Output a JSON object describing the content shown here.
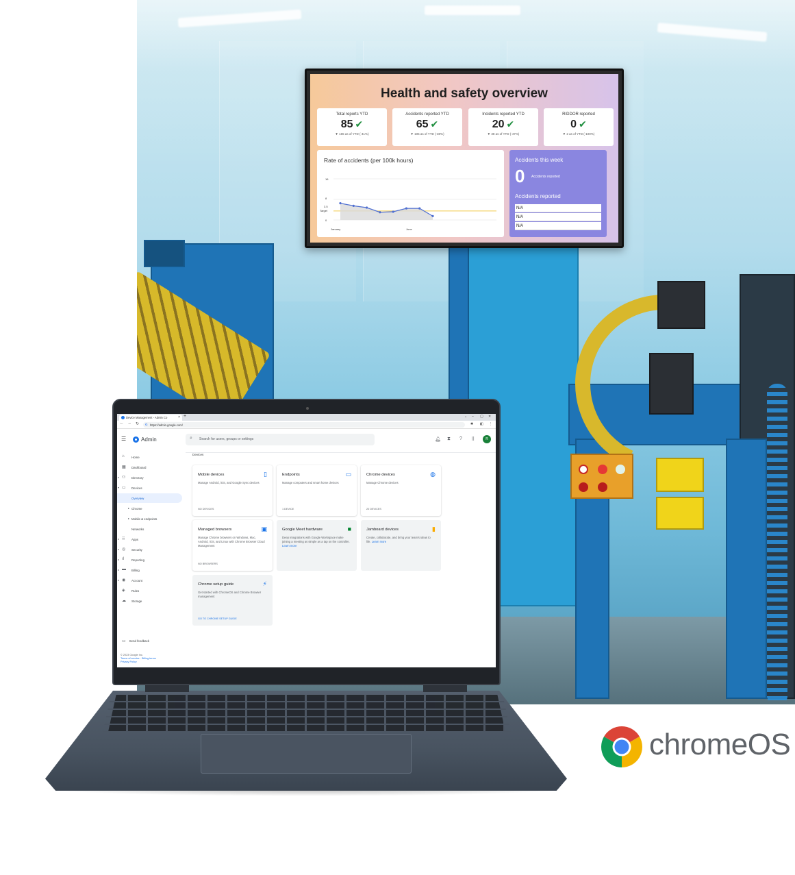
{
  "tv_dashboard": {
    "title": "Health and safety overview",
    "kpis": [
      {
        "label": "Total reports YTD",
        "value": "85",
        "sub": "▼ 165 as of YTD (-41%)"
      },
      {
        "label": "Accidents reported YTD",
        "value": "65",
        "sub": "▼ 105 as of YTD (-38%)"
      },
      {
        "label": "Incidents reported YTD",
        "value": "20",
        "sub": "▼ 38 as of YTD (-47%)"
      },
      {
        "label": "RIDDOR reported",
        "value": "0",
        "sub": "▼ 2 as of YTD (-100%)"
      }
    ],
    "chart_title": "Rate of accidents (per 100k hours)",
    "chart_yticks": [
      "16",
      "8",
      "3.5",
      "Target",
      "0"
    ],
    "chart_xticks": [
      "January",
      "June"
    ],
    "accidents_week_title": "Accidents this week",
    "accidents_week_value": "0",
    "accidents_week_label": "Accidents reported",
    "accidents_reported_title": "Accidents reported",
    "accidents_reported_rows": [
      "N/A",
      "N/A",
      "N/A"
    ]
  },
  "chart_data": {
    "type": "line",
    "title": "Rate of accidents (per 100k hours)",
    "x": [
      "January",
      "",
      "",
      "",
      "",
      "June",
      "",
      ""
    ],
    "series": [
      {
        "name": "",
        "values": [
          6.5,
          5.5,
          4.8,
          3.0,
          3.2,
          4.5,
          4.5,
          1.5
        ]
      }
    ],
    "ylim": [
      0,
      16
    ],
    "target": 3.5
  },
  "browser": {
    "tab_title": "Device Management - Admin Co",
    "new_tab": "+",
    "url": "https://admin.google.com/",
    "controls": {
      "min": "–",
      "max": "▢",
      "close": "✕"
    }
  },
  "admin": {
    "app_name": "Admin",
    "search_placeholder": "Search for users, groups or settings",
    "avatar_initial": "R",
    "breadcrumb": "Devices",
    "sidebar": [
      {
        "label": "Home",
        "icon": "⌂",
        "caret": ""
      },
      {
        "label": "Dashboard",
        "icon": "▦",
        "caret": ""
      },
      {
        "label": "Directory",
        "icon": "⚇",
        "caret": "▸"
      },
      {
        "label": "Devices",
        "icon": "▭",
        "caret": "▾"
      },
      {
        "label": "Overview",
        "icon": "",
        "caret": ""
      },
      {
        "label": "Chrome",
        "icon": "",
        "caret": "▸"
      },
      {
        "label": "Mobile & endpoints",
        "icon": "",
        "caret": "▸"
      },
      {
        "label": "Networks",
        "icon": "",
        "caret": ""
      },
      {
        "label": "Apps",
        "icon": "⠿",
        "caret": "▸"
      },
      {
        "label": "Security",
        "icon": "◎",
        "caret": "▸"
      },
      {
        "label": "Reporting",
        "icon": "ıl",
        "caret": "▸"
      },
      {
        "label": "Billing",
        "icon": "▬",
        "caret": "▸"
      },
      {
        "label": "Account",
        "icon": "◉",
        "caret": "▸"
      },
      {
        "label": "Rules",
        "icon": "◈",
        "caret": ""
      },
      {
        "label": "Storage",
        "icon": "☁",
        "caret": ""
      }
    ],
    "send_feedback": "Send feedback",
    "footer": {
      "copyright": "© 2023 Google Inc.",
      "terms": "Terms of service",
      "billing_terms": "Billing terms",
      "privacy": "Privacy Policy"
    },
    "cards": [
      {
        "name": "Mobile devices",
        "desc": "Manage Android, iOS, and Google Sync devices",
        "count": "NO DEVICES",
        "icon": "▯",
        "icon_color": "#1a73e8"
      },
      {
        "name": "Endpoints",
        "desc": "Manage computers and smart home devices",
        "count": "1 DEVICE",
        "icon": "▭",
        "icon_color": "#1a73e8"
      },
      {
        "name": "Chrome devices",
        "desc": "Manage Chrome devices",
        "count": "20 DEVICES",
        "icon": "◍",
        "icon_color": "#1a73e8"
      },
      {
        "name": "Managed browsers",
        "desc": "Manage Chrome browsers on Windows, Mac, Android, iOS, and Linux with Chrome Browser Cloud Management",
        "count": "NO BROWSERS",
        "icon": "▣",
        "icon_color": "#1a73e8"
      },
      {
        "name": "Google Meet hardware",
        "desc": "Deep integrations with Google Workspace make joining a meeting as simple as a tap on the controller.",
        "link": "Learn more",
        "icon": "■",
        "icon_color": "#00832d"
      },
      {
        "name": "Jamboard devices",
        "desc": "Create, collaborate, and bring your team's ideas to life.",
        "link": "Learn more",
        "icon": "▮",
        "icon_color": "#f9ab00"
      },
      {
        "name": "Chrome setup guide",
        "desc": "Get started with ChromeOS and Chrome Browser management",
        "cta": "GO TO CHROME SETUP GUIDE",
        "icon": "⚡",
        "icon_color": "#1a73e8"
      }
    ]
  },
  "brand": {
    "wordmark": "chromeOS",
    "colors": {
      "red": "#db4437",
      "yellow": "#f4b400",
      "green": "#0f9d58",
      "blue": "#4285f4"
    }
  }
}
